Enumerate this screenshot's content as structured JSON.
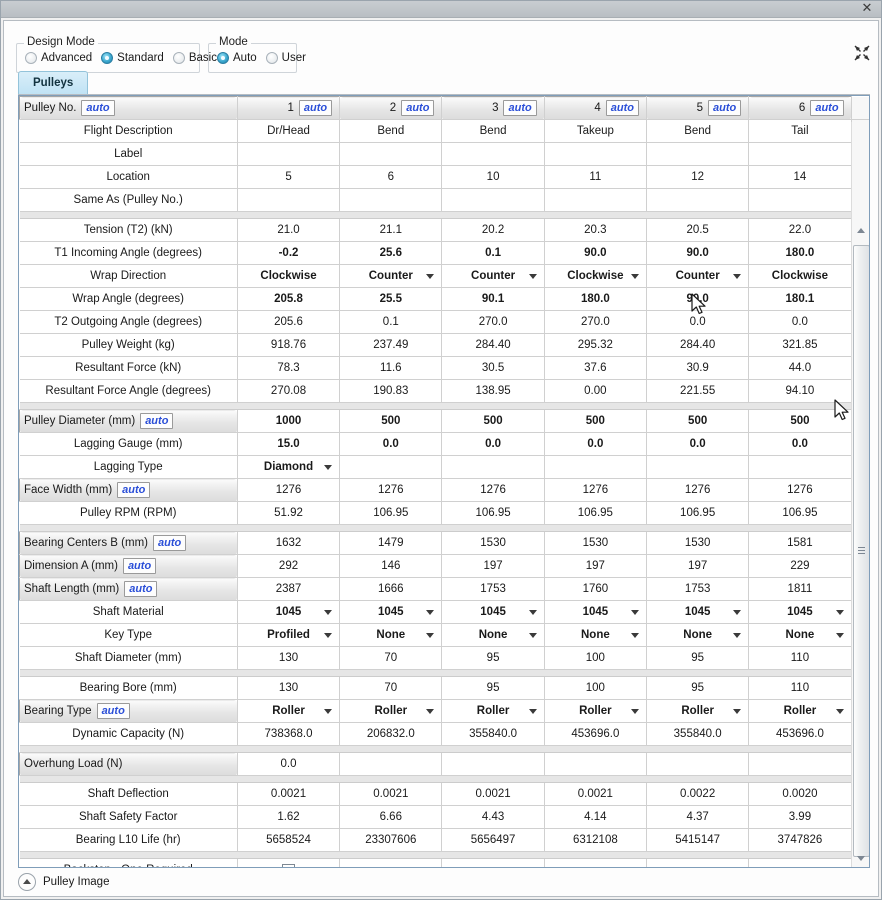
{
  "window": {
    "close_label": "✕",
    "collapse_icon": "collapse-arrows-icon"
  },
  "design_mode_group": {
    "title": "Design Mode",
    "options": [
      "Advanced",
      "Standard",
      "Basic"
    ],
    "selected": "Standard"
  },
  "mode_group": {
    "title": "Mode",
    "options": [
      "Auto",
      "User"
    ],
    "selected": "Auto"
  },
  "tabs": [
    {
      "label": "Pulleys",
      "active": true
    }
  ],
  "grid": {
    "auto_badge": "auto",
    "header": {
      "row_label": "Pulley No.",
      "columns": [
        {
          "num": "1",
          "auto": "auto"
        },
        {
          "num": "2",
          "auto": "auto"
        },
        {
          "num": "3",
          "auto": "auto"
        },
        {
          "num": "4",
          "auto": "auto"
        },
        {
          "num": "5",
          "auto": "auto"
        },
        {
          "num": "6",
          "auto": "auto"
        }
      ]
    },
    "rows": [
      {
        "label": "Flight Description",
        "values": [
          "Dr/Head",
          "Bend",
          "Bend",
          "Takeup",
          "Bend",
          "Tail"
        ]
      },
      {
        "label": "Label",
        "values": [
          "",
          "",
          "",
          "",
          "",
          ""
        ]
      },
      {
        "label": "Location",
        "values": [
          "5",
          "6",
          "10",
          "11",
          "12",
          "14"
        ]
      },
      {
        "label": "Same As (Pulley No.)",
        "values": [
          "",
          "",
          "",
          "",
          "",
          ""
        ]
      },
      {
        "separator": true
      },
      {
        "label": "Tension (T2) (kN)",
        "values": [
          "21.0",
          "21.1",
          "20.2",
          "20.3",
          "20.5",
          "22.0"
        ]
      },
      {
        "label": "T1 Incoming Angle (degrees)",
        "style": "blue",
        "values": [
          "-0.2",
          "25.6",
          "0.1",
          "90.0",
          "90.0",
          "180.0"
        ]
      },
      {
        "label": "Wrap Direction",
        "combo": [
          false,
          true,
          true,
          true,
          true,
          false
        ],
        "style": "combo-blue",
        "values": [
          "Clockwise",
          "Counter",
          "Counter",
          "Clockwise",
          "Counter",
          "Clockwise"
        ]
      },
      {
        "label": "Wrap Angle (degrees)",
        "style": "blue",
        "values": [
          "205.8",
          "25.5",
          "90.1",
          "180.0",
          "90.0",
          "180.1"
        ]
      },
      {
        "label": "T2 Outgoing Angle (degrees)",
        "values": [
          "205.6",
          "0.1",
          "270.0",
          "270.0",
          "0.0",
          "0.0"
        ]
      },
      {
        "label": "Pulley Weight (kg)",
        "values": [
          "918.76",
          "237.49",
          "284.40",
          "295.32",
          "284.40",
          "321.85"
        ]
      },
      {
        "label": "Resultant Force (kN)",
        "values": [
          "78.3",
          "11.6",
          "30.5",
          "37.6",
          "30.9",
          "44.0"
        ]
      },
      {
        "label": "Resultant Force Angle (degrees)",
        "values": [
          "270.08",
          "190.83",
          "138.95",
          "0.00",
          "221.55",
          "94.10"
        ]
      },
      {
        "separator": true
      },
      {
        "label": "Pulley Diameter (mm)",
        "header_cell": true,
        "auto": "auto",
        "style": "blue",
        "values": [
          "1000",
          "500",
          "500",
          "500",
          "500",
          "500"
        ]
      },
      {
        "label": "Lagging Gauge (mm)",
        "style": "blue",
        "values": [
          "15.0",
          "0.0",
          "0.0",
          "0.0",
          "0.0",
          "0.0"
        ]
      },
      {
        "label": "Lagging Type",
        "combo": [
          true,
          false,
          false,
          false,
          false,
          false
        ],
        "style": "combo-blue",
        "values": [
          "Diamond",
          "",
          "",
          "",
          "",
          ""
        ]
      },
      {
        "label": "Face Width (mm)",
        "header_cell": true,
        "auto": "auto",
        "style": "bluethin",
        "values": [
          "1276",
          "1276",
          "1276",
          "1276",
          "1276",
          "1276"
        ]
      },
      {
        "label": "Pulley RPM (RPM)",
        "values": [
          "51.92",
          "106.95",
          "106.95",
          "106.95",
          "106.95",
          "106.95"
        ]
      },
      {
        "separator": true
      },
      {
        "label": "Bearing Centers B (mm)",
        "header_cell": true,
        "auto": "auto",
        "style": "bluethin",
        "values": [
          "1632",
          "1479",
          "1530",
          "1530",
          "1530",
          "1581"
        ]
      },
      {
        "label": "Dimension A (mm)",
        "header_cell": true,
        "auto": "auto",
        "style": "bluethin",
        "values": [
          "292",
          "146",
          "197",
          "197",
          "197",
          "229"
        ]
      },
      {
        "label": "Shaft Length (mm)",
        "header_cell": true,
        "auto": "auto",
        "style": "bluethin",
        "values": [
          "2387",
          "1666",
          "1753",
          "1760",
          "1753",
          "1811"
        ]
      },
      {
        "label": "Shaft Material",
        "combo": [
          true,
          true,
          true,
          true,
          true,
          true
        ],
        "style": "combo-blue",
        "values": [
          "1045",
          "1045",
          "1045",
          "1045",
          "1045",
          "1045"
        ]
      },
      {
        "label": "Key Type",
        "combo": [
          true,
          true,
          true,
          true,
          true,
          true
        ],
        "style": "combo-blue",
        "values": [
          "Profiled",
          "None",
          "None",
          "None",
          "None",
          "None"
        ]
      },
      {
        "label": "Shaft Diameter (mm)",
        "values": [
          "130",
          "70",
          "95",
          "100",
          "95",
          "110"
        ]
      },
      {
        "separator": true
      },
      {
        "label": "Bearing Bore (mm)",
        "values": [
          "130",
          "70",
          "95",
          "100",
          "95",
          "110"
        ]
      },
      {
        "label": "Bearing Type",
        "header_cell": true,
        "auto": "auto",
        "combo": [
          true,
          true,
          true,
          true,
          true,
          true
        ],
        "style": "combo-blue",
        "values": [
          "Roller",
          "Roller",
          "Roller",
          "Roller",
          "Roller",
          "Roller"
        ]
      },
      {
        "label": "Dynamic Capacity (N)",
        "values": [
          "738368.0",
          "206832.0",
          "355840.0",
          "453696.0",
          "355840.0",
          "453696.0"
        ]
      },
      {
        "separator": true
      },
      {
        "label": "Overhung Load (N)",
        "header_cell": true,
        "style": "bluethin",
        "values": [
          "0.0",
          "",
          "",
          "",
          "",
          ""
        ]
      },
      {
        "separator": true
      },
      {
        "label": "Shaft Deflection",
        "values": [
          "0.0021",
          "0.0021",
          "0.0021",
          "0.0021",
          "0.0022",
          "0.0020"
        ]
      },
      {
        "label": "Shaft Safety Factor",
        "values": [
          "1.62",
          "6.66",
          "4.43",
          "4.14",
          "4.37",
          "3.99"
        ]
      },
      {
        "label": "Bearing L10 Life (hr)",
        "values": [
          "5658524",
          "23307606",
          "5656497",
          "6312108",
          "5415147",
          "3747826"
        ]
      },
      {
        "separator": true
      },
      {
        "label": "Backstop - One Required",
        "checkbox": [
          true,
          false,
          false,
          false,
          false,
          false
        ],
        "values": [
          "",
          "",
          "",
          "",
          "",
          ""
        ]
      }
    ]
  },
  "footer": {
    "expander_icon": "chevron-up-icon",
    "label": "Pulley Image"
  },
  "colors": {
    "accent_blue": "#0b22d6",
    "tab_active": "#bfe2f4",
    "radio_checked": "#3da9cf"
  }
}
